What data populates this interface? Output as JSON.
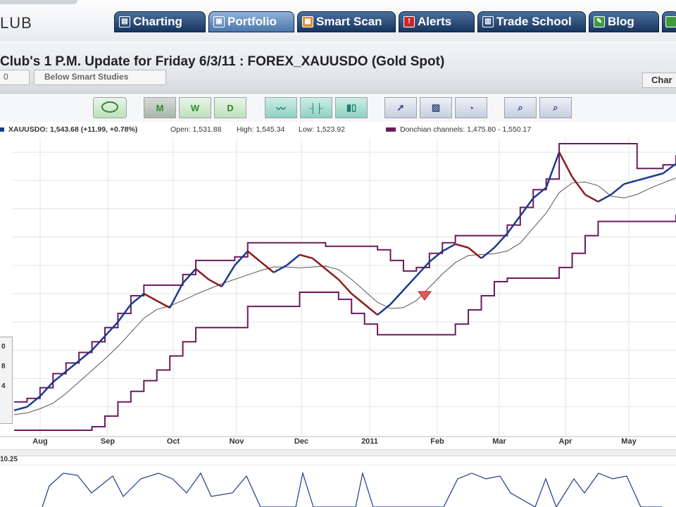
{
  "app": {
    "logo_text": "LUB"
  },
  "nav": {
    "tabs": [
      {
        "label": "Charting",
        "icon": "chart-icon",
        "active": false
      },
      {
        "label": "Portfolio",
        "icon": "portfolio-icon",
        "active": true
      },
      {
        "label": "Smart Scan",
        "icon": "scan-icon",
        "active": false
      },
      {
        "label": "Alerts",
        "icon": "alert-icon",
        "active": false
      },
      {
        "label": "Trade School",
        "icon": "school-icon",
        "active": false
      },
      {
        "label": "Blog",
        "icon": "blog-icon",
        "active": false
      }
    ]
  },
  "page": {
    "title": "Club's 1 P.M. Update for Friday 6/3/11 : FOREX_XAUUSDO (Gold Spot)"
  },
  "controls": {
    "dropdown_1": "0",
    "dropdown_2": "Below Smart Studies",
    "chart_button": "Char"
  },
  "toolbar": {
    "buttons": [
      "comment-icon",
      "M",
      "W",
      "D",
      "line-chart-icon",
      "ohlc-chart-icon",
      "candle-chart-icon",
      "pointer-icon",
      "draw-icon",
      "zoom-fit-icon",
      "zoom-in-icon",
      "zoom-out-icon"
    ]
  },
  "legend": {
    "symbol": "XAUUSDO",
    "last": "1,543.68",
    "change": "(+11.99, +0.78%)",
    "open_label": "Open:",
    "open": "1,531.88",
    "high_label": "High:",
    "high": "1,545.34",
    "low_label": "Low:",
    "low": "1,523.92",
    "donchian_label": "Donchian channels:",
    "donchian_values": "1,475.80 - 1,550.17"
  },
  "colors": {
    "donchian": "#6b1a5e",
    "up": "#1b3b8c",
    "down": "#8a1b1b",
    "grid": "#e3e3e3"
  },
  "chart_data": {
    "type": "line",
    "x_axis_labels": [
      "Aug",
      "Sep",
      "Oct",
      "Nov",
      "Dec",
      "2011",
      "Feb",
      "Mar",
      "Apr",
      "May"
    ],
    "series": [
      {
        "name": "XAUUSDO",
        "values": [
          1195,
          1200,
          1215,
          1235,
          1250,
          1265,
          1280,
          1300,
          1320,
          1345,
          1360,
          1350,
          1340,
          1375,
          1395,
          1380,
          1370,
          1400,
          1420,
          1405,
          1390,
          1400,
          1415,
          1410,
          1395,
          1380,
          1360,
          1345,
          1330,
          1345,
          1365,
          1385,
          1405,
          1420,
          1430,
          1425,
          1410,
          1425,
          1445,
          1470,
          1495,
          1510,
          1560,
          1525,
          1500,
          1490,
          1500,
          1515,
          1520,
          1525,
          1530,
          1543.68
        ]
      }
    ],
    "donchian": {
      "upper_last": 1550.17,
      "lower_last": 1475.8
    },
    "axis_side_labels": [
      "0",
      "8",
      "4"
    ]
  },
  "oscillator": {
    "label": "10.25"
  }
}
